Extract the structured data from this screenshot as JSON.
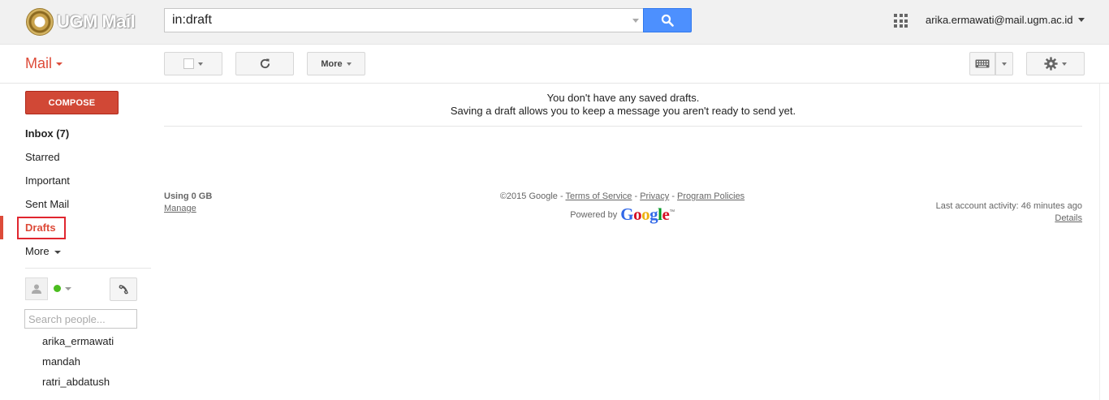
{
  "header": {
    "logo_text": "UGM Mail",
    "search_value": "in:draft",
    "account_email": "arika.ermawati@mail.ugm.ac.id"
  },
  "toolbar": {
    "mail_label": "Mail",
    "more_label": "More"
  },
  "sidebar": {
    "compose_label": "COMPOSE",
    "items": [
      {
        "label": "Inbox (7)",
        "bold": true
      },
      {
        "label": "Starred"
      },
      {
        "label": "Important"
      },
      {
        "label": "Sent Mail"
      },
      {
        "label": "Drafts",
        "active": true
      },
      {
        "label": "More"
      }
    ],
    "people_search_placeholder": "Search people...",
    "contacts": [
      "arika_ermawati",
      "mandah",
      "ratri_abdatush"
    ]
  },
  "main": {
    "empty_line1": "You don't have any saved drafts.",
    "empty_line2": "Saving a draft allows you to keep a message you aren't ready to send yet."
  },
  "footer": {
    "usage": "Using 0 GB",
    "manage": "Manage",
    "copyright": "©2015 Google",
    "terms": "Terms of Service",
    "privacy": "Privacy",
    "policies": "Program Policies",
    "powered_by": "Powered by",
    "last_activity": "Last account activity: 46 minutes ago",
    "details": "Details"
  },
  "colors": {
    "accent_red": "#dd4b39",
    "compose_red": "#d14836",
    "search_blue": "#4d90fe",
    "online_green": "#4bbd1f"
  }
}
